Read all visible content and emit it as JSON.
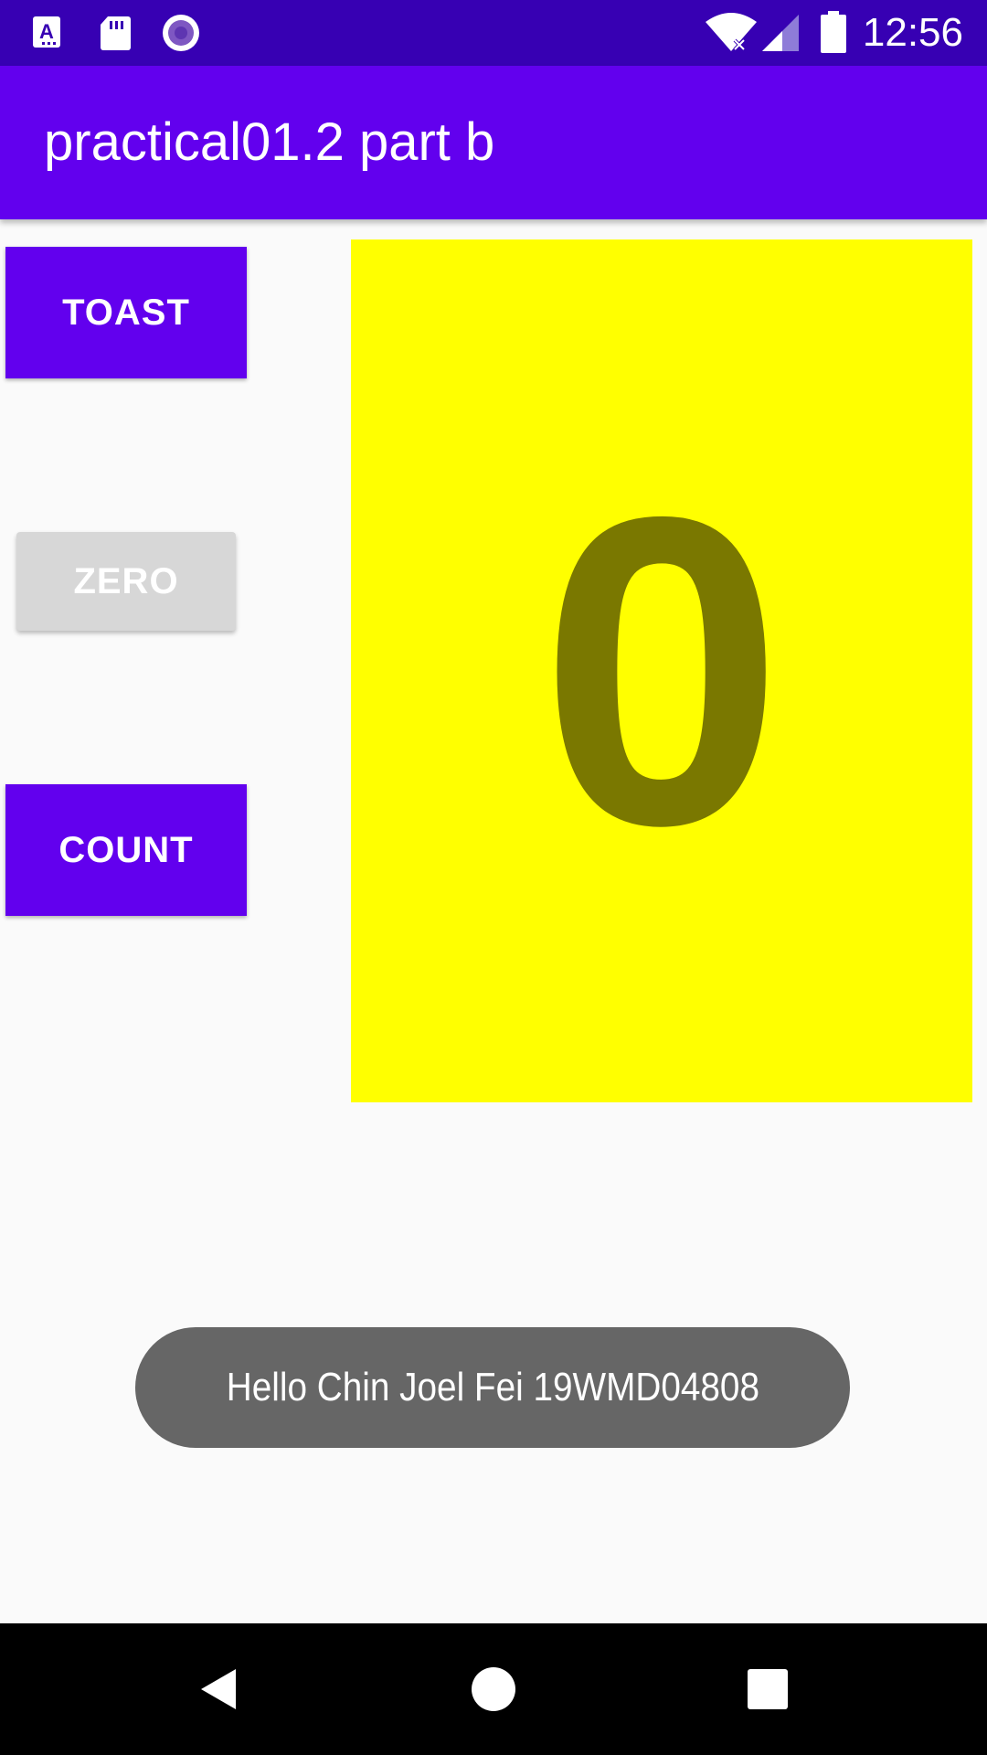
{
  "status_bar": {
    "time": "12:56",
    "left_icons": [
      "app-a-icon",
      "sd-card-icon",
      "record-circle-icon"
    ],
    "right_icons": [
      "wifi-off-icon",
      "cell-signal-icon",
      "battery-icon"
    ],
    "color": "#3700B3"
  },
  "app_bar": {
    "title": "practical01.2 part b",
    "color": "#6200EE"
  },
  "buttons": {
    "toast_label": "TOAST",
    "zero_label": "ZERO",
    "count_label": "COUNT"
  },
  "counter": {
    "value": "0",
    "background": "#FFFF00",
    "text_color": "#7A7800"
  },
  "toast": {
    "message": "Hello Chin Joel Fei 19WMD04808"
  },
  "nav_bar": {
    "icons": [
      "back-icon",
      "home-icon",
      "recents-icon"
    ]
  }
}
